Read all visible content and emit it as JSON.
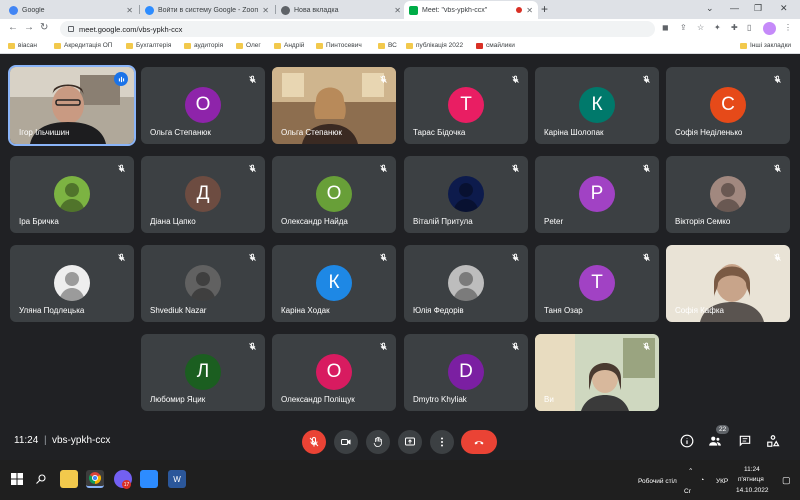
{
  "browser": {
    "tabs": [
      {
        "label": "Google",
        "color": "#4285f4"
      },
      {
        "label": "Войти в систему Google - Zoom",
        "color": "#2d8cff"
      },
      {
        "label": "Нова вкладка",
        "color": "#5f6368"
      },
      {
        "label": "Meet: \"vbs-ypkh-ccx\"",
        "color": "#00ac47",
        "active": true
      }
    ],
    "url": "meet.google.com/vbs-ypkh-ccx",
    "bookmarks": [
      "віасан",
      "Акредитація ОП",
      "Бухгалтерія",
      "аудиторія",
      "Олег",
      "Андрій",
      "Пинтосевич",
      "ВС",
      "публікація 2022",
      "смайлики"
    ],
    "bookmarks_other": "Інші закладки"
  },
  "meet": {
    "participants": [
      {
        "name": "Ігор Ільчишин",
        "type": "video",
        "speaking": true
      },
      {
        "name": "Ольга Степанюк",
        "type": "letter",
        "letter": "О",
        "color": "#8e24aa"
      },
      {
        "name": "Ольга Степанюк",
        "type": "video2"
      },
      {
        "name": "Тарас Бідочка",
        "type": "letter",
        "letter": "Т",
        "color": "#e91e63"
      },
      {
        "name": "Каріна Шолопак",
        "type": "letter",
        "letter": "К",
        "color": "#00796b"
      },
      {
        "name": "Софія Неділенько",
        "type": "letter",
        "letter": "С",
        "color": "#e64a19"
      },
      {
        "name": "Іра Бричка",
        "type": "photo",
        "color": "#7cb342"
      },
      {
        "name": "Діана Цапко",
        "type": "letter",
        "letter": "Д",
        "color": "#6d4c41"
      },
      {
        "name": "Олександр Найда",
        "type": "letter",
        "letter": "О",
        "color": "#689f38"
      },
      {
        "name": "Віталій Притула",
        "type": "photo",
        "color": "#0d1b4c"
      },
      {
        "name": "Peter",
        "type": "letter",
        "letter": "P",
        "color": "#a142c4"
      },
      {
        "name": "Вікторія Семко",
        "type": "photo",
        "color": "#a1887f"
      },
      {
        "name": "Уляна Подлецька",
        "type": "photo",
        "color": "#eeeeee"
      },
      {
        "name": "Shvediuk Nazar",
        "type": "photo",
        "color": "#616161"
      },
      {
        "name": "Каріна Ходак",
        "type": "letter",
        "letter": "К",
        "color": "#1e88e5"
      },
      {
        "name": "Юлія Федорів",
        "type": "photo",
        "color": "#bdbdbd"
      },
      {
        "name": "Таня Озар",
        "type": "letter",
        "letter": "Т",
        "color": "#a142c4"
      },
      {
        "name": "Софія Кафка",
        "type": "video3"
      },
      {
        "name": "Любомир Яцик",
        "type": "letter",
        "letter": "Л",
        "color": "#1b5e20"
      },
      {
        "name": "Олександр Поліщук",
        "type": "letter",
        "letter": "О",
        "color": "#d81b60"
      },
      {
        "name": "Dmytro Khyliak",
        "type": "letter",
        "letter": "D",
        "color": "#7b1fa2"
      },
      {
        "name": "Ви",
        "type": "video4"
      }
    ],
    "time": "11:24",
    "meeting_code": "vbs-ypkh-ccx",
    "people_count": "22"
  },
  "taskbar": {
    "desktop_label": "Робочий стіл",
    "lang": "УКР",
    "lang2": "Cr",
    "time": "11:24",
    "day": "п'ятниця",
    "date": "14.10.2022",
    "teams_badge": "17"
  }
}
